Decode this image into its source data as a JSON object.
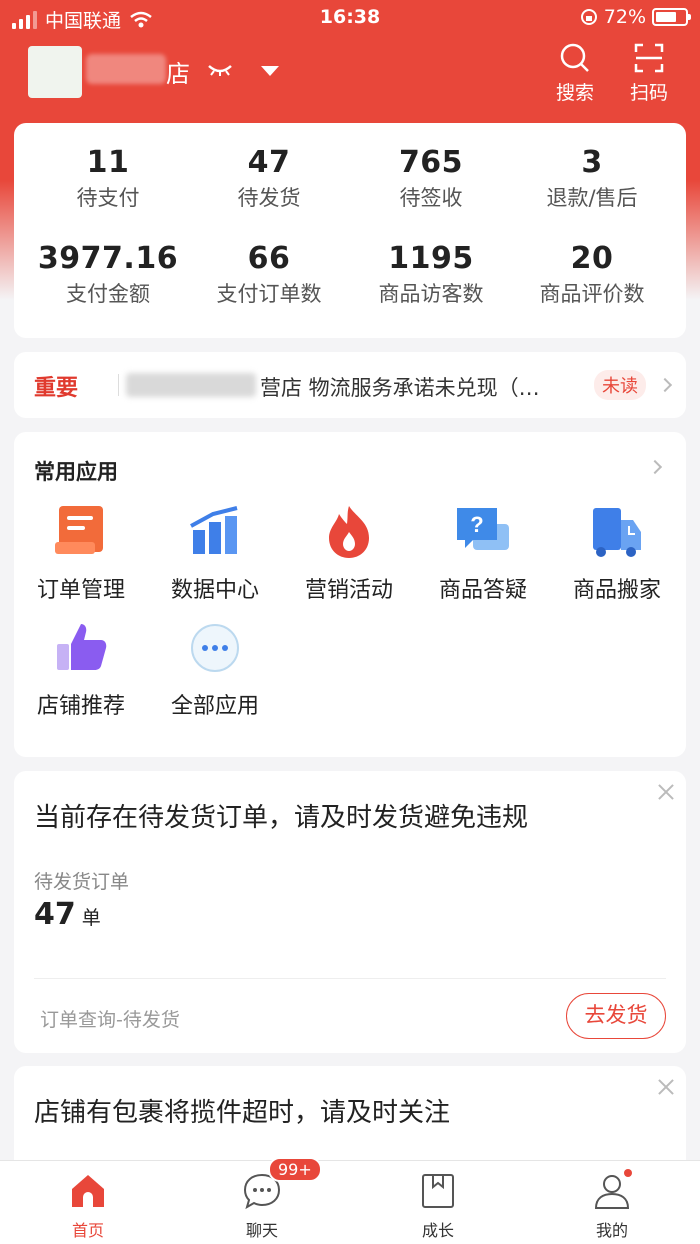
{
  "status_bar": {
    "carrier": "中国联通",
    "time": "16:38",
    "battery_percent": "72%",
    "battery_level": 0.72
  },
  "header": {
    "store_name_suffix": "店",
    "search_label": "搜索",
    "scan_label": "扫码"
  },
  "stats": {
    "row1": [
      {
        "value": "11",
        "label": "待支付"
      },
      {
        "value": "47",
        "label": "待发货"
      },
      {
        "value": "765",
        "label": "待签收"
      },
      {
        "value": "3",
        "label": "退款/售后"
      }
    ],
    "row2": [
      {
        "value": "3977.16",
        "label": "支付金额"
      },
      {
        "value": "66",
        "label": "支付订单数"
      },
      {
        "value": "1195",
        "label": "商品访客数"
      },
      {
        "value": "20",
        "label": "商品评价数"
      }
    ]
  },
  "notice": {
    "tag": "重要",
    "text": "营店 物流服务承诺未兑现（…",
    "badge": "未读"
  },
  "apps": {
    "title": "常用应用",
    "items": [
      {
        "label": "订单管理",
        "icon": "order-icon"
      },
      {
        "label": "数据中心",
        "icon": "chart-icon"
      },
      {
        "label": "营销活动",
        "icon": "fire-icon"
      },
      {
        "label": "商品答疑",
        "icon": "qa-icon"
      },
      {
        "label": "商品搬家",
        "icon": "truck-icon"
      },
      {
        "label": "店铺推荐",
        "icon": "thumbs-up-icon"
      },
      {
        "label": "全部应用",
        "icon": "more-icon"
      }
    ]
  },
  "alert": {
    "title": "当前存在待发货订单，请及时发货避免违规",
    "sub_label": "待发货订单",
    "count": "47",
    "unit": "单",
    "link": "订单查询-待发货",
    "button": "去发货"
  },
  "alert2": {
    "title": "店铺有包裹将揽件超时，请及时关注"
  },
  "tabs": [
    {
      "label": "首页",
      "icon": "home-icon",
      "active": true
    },
    {
      "label": "聊天",
      "icon": "chat-icon",
      "badge": "99+"
    },
    {
      "label": "成长",
      "icon": "book-icon"
    },
    {
      "label": "我的",
      "icon": "user-icon"
    }
  ],
  "colors": {
    "brand_red": "#e8473a",
    "background": "#f4f4f6"
  }
}
